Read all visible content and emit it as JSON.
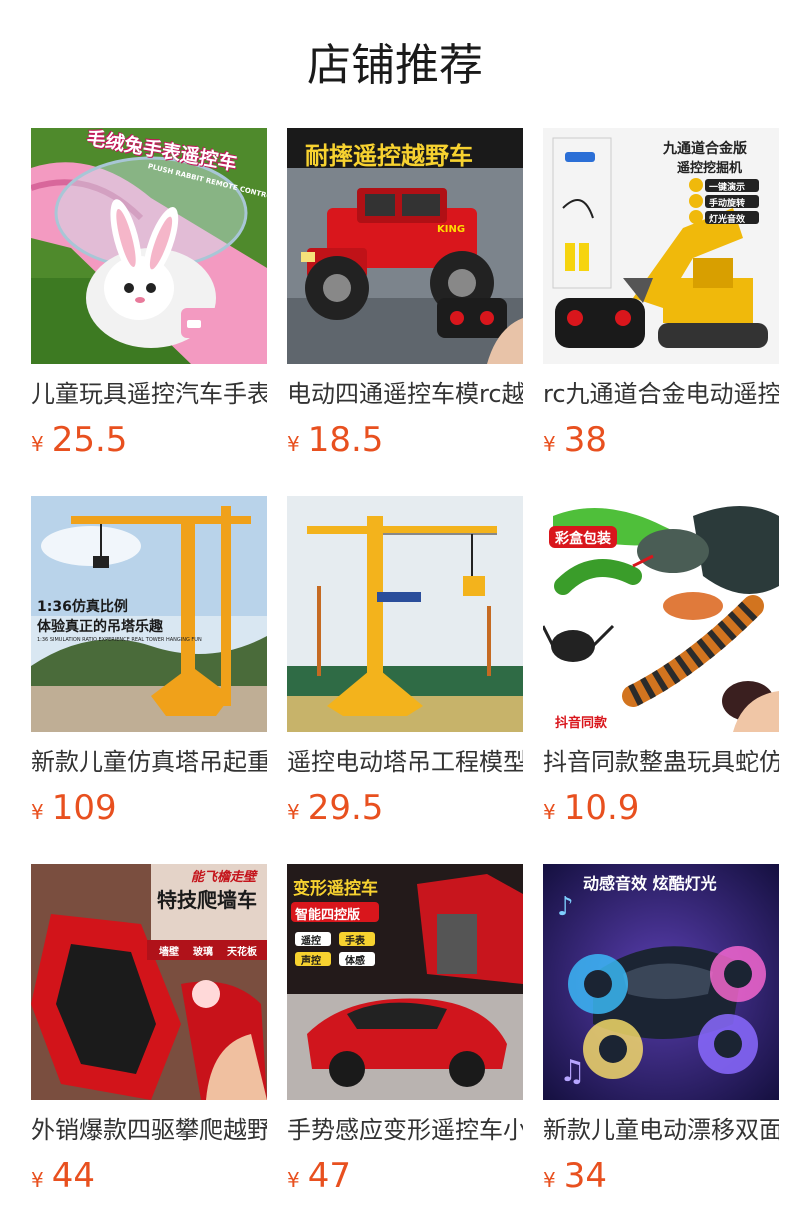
{
  "page": {
    "title": "店铺推荐"
  },
  "products": [
    {
      "name": "儿童玩具遥控汽车手表",
      "currency": "¥",
      "price": "25.5",
      "image_text": "毛绒兔手表遥控车",
      "image_subtext": "PLUSH RABBIT REMOTE CONTROL",
      "image_kind": "rabbit-watch-car"
    },
    {
      "name": "电动四通遥控车模rc越野车",
      "currency": "¥",
      "price": "18.5",
      "image_text": "耐摔遥控越野车",
      "image_subtext": "KING",
      "image_kind": "offroad-jeep"
    },
    {
      "name": "rc九通道合金电动遥控挖掘机",
      "currency": "¥",
      "price": "38",
      "image_text": "九通道合金版",
      "image_subtext": "遥控挖掘机",
      "image_badges": [
        "一键演示",
        "手动旋转",
        "灯光音效"
      ],
      "image_kind": "excavator"
    },
    {
      "name": "新款儿童仿真塔吊起重机",
      "currency": "¥",
      "price": "109",
      "image_text": "1:36仿真比例",
      "image_subtext": "体验真正的吊塔乐趣",
      "image_caption": "1:36 SIMULATION RATIO EXPERIENCE REAL TOWER HANGING FUN",
      "image_kind": "tower-crane-a"
    },
    {
      "name": "遥控电动塔吊工程模型",
      "currency": "¥",
      "price": "29.5",
      "image_kind": "tower-crane-b"
    },
    {
      "name": "抖音同款整蛊玩具蛇仿真",
      "currency": "¥",
      "price": "10.9",
      "image_text": "彩盒包装",
      "image_subtext": "抖音同款",
      "image_kind": "snake-centipede"
    },
    {
      "name": "外销爆款四驱攀爬越野车",
      "currency": "¥",
      "price": "44",
      "image_text": "特技爬墙车",
      "image_subtext": "能飞檐走壁",
      "image_badges": [
        "墙壁",
        "玻璃",
        "天花板"
      ],
      "image_kind": "wall-climbing-car"
    },
    {
      "name": "手势感应变形遥控车小孩",
      "currency": "¥",
      "price": "47",
      "image_text": "变形遥控车",
      "image_subtext": "智能四控版",
      "image_badges": [
        "遥控",
        "手表",
        "声控",
        "体感"
      ],
      "image_kind": "transforming-car"
    },
    {
      "name": "新款儿童电动漂移双面车",
      "currency": "¥",
      "price": "34",
      "image_text": "动感音效 炫酷灯光",
      "image_kind": "stunt-car"
    }
  ],
  "colors": {
    "price": "#e8501f",
    "title": "#1a1a1a",
    "name": "#333333"
  }
}
